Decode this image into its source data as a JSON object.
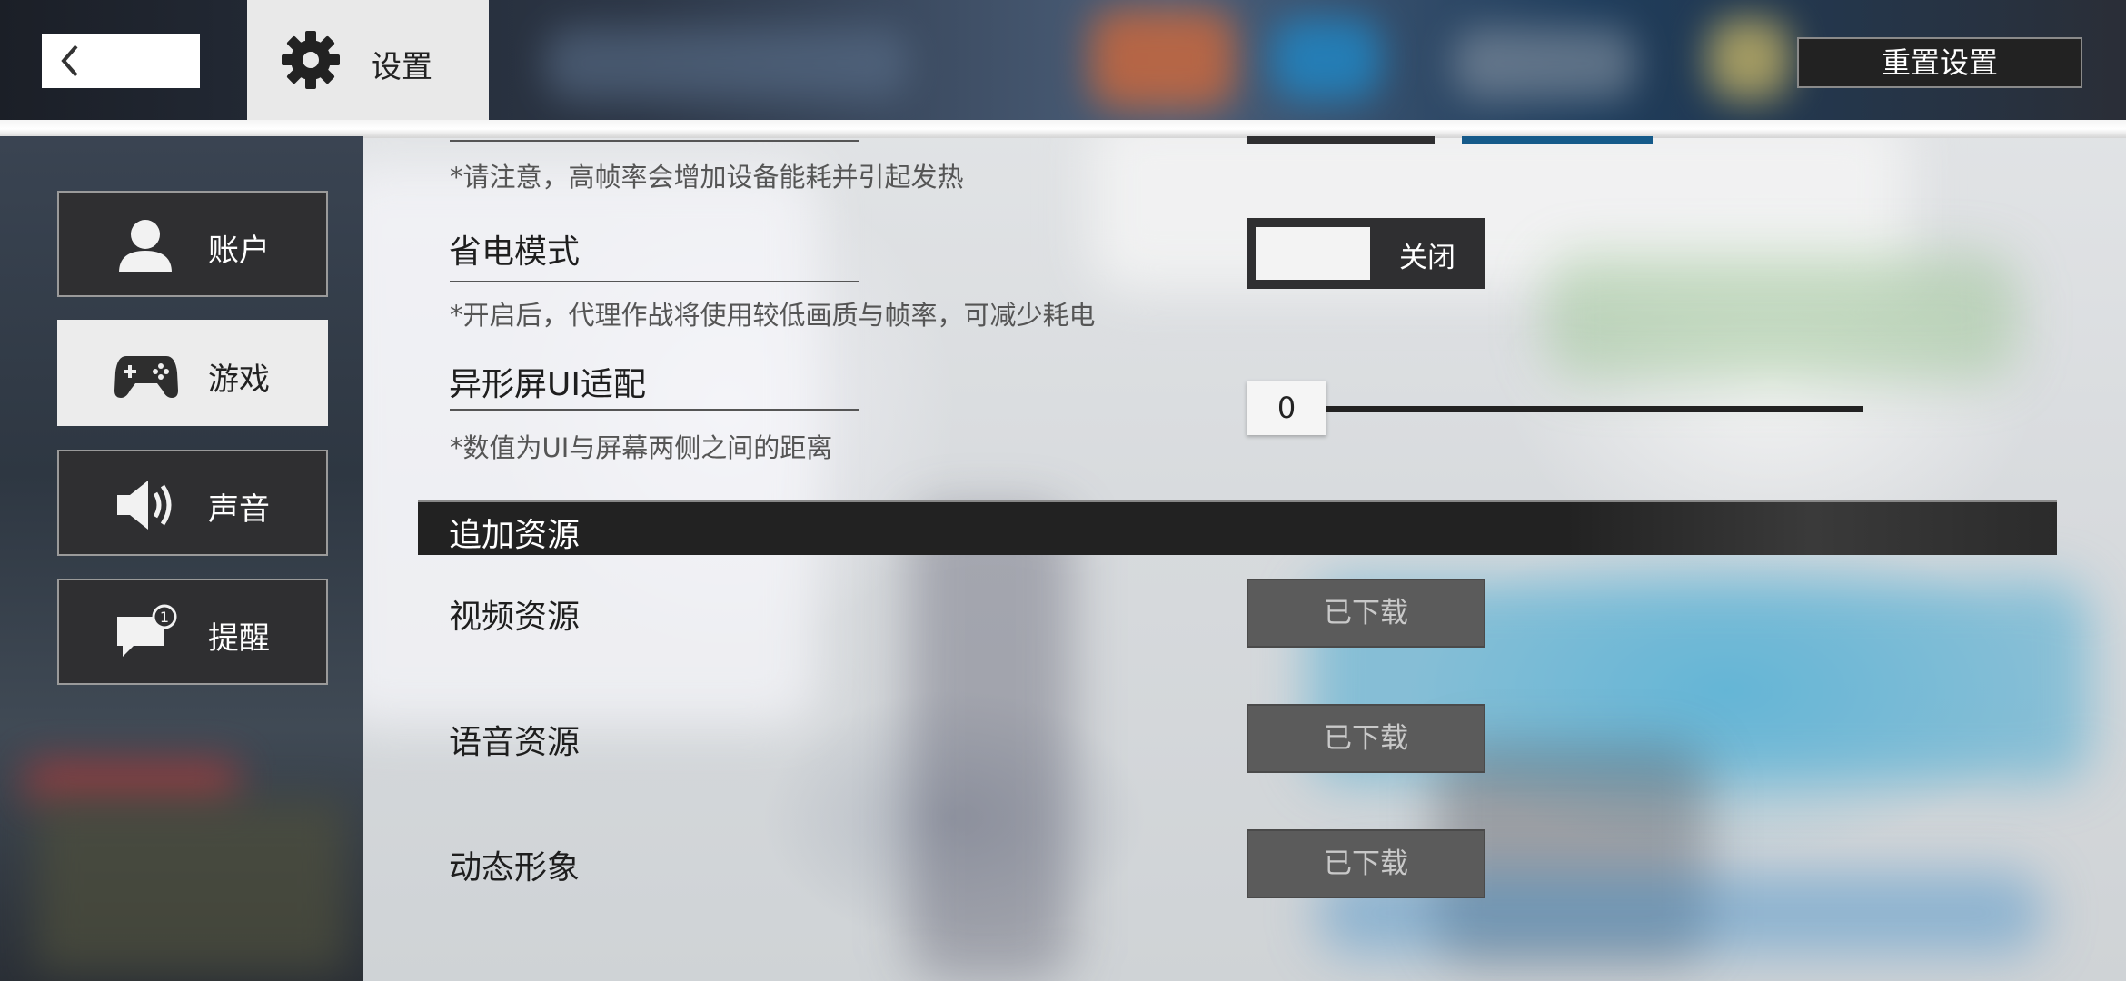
{
  "header": {
    "back_icon": "chevron-left-icon",
    "title_icon": "gear-icon",
    "title": "设置",
    "reset_label": "重置设置"
  },
  "sidebar": {
    "items": [
      {
        "label": "账户",
        "icon": "user-icon",
        "active": false
      },
      {
        "label": "游戏",
        "icon": "gamepad-icon",
        "active": true
      },
      {
        "label": "声音",
        "icon": "speaker-icon",
        "active": false
      },
      {
        "label": "提醒",
        "icon": "notification-icon",
        "active": false
      }
    ]
  },
  "settings": {
    "frame_rate_note": "*请注意，高帧率会增加设备能耗并引起发热",
    "power_saving": {
      "label": "省电模式",
      "note": "*开启后，代理作战将使用较低画质与帧率，可减少耗电",
      "state": "关闭"
    },
    "notch_adapt": {
      "label": "异形屏UI适配",
      "note": "*数值为UI与屏幕两侧之间的距离",
      "value": "0"
    }
  },
  "resources": {
    "section_title": "追加资源",
    "items": [
      {
        "label": "视频资源",
        "status": "已下载"
      },
      {
        "label": "语音资源",
        "status": "已下载"
      },
      {
        "label": "动态形象",
        "status": "已下载"
      }
    ]
  }
}
